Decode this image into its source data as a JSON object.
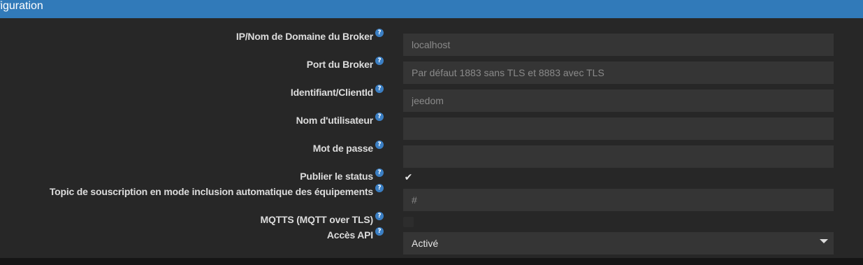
{
  "header": {
    "title": "figuration",
    "color": "#317ab9"
  },
  "help_glyph": "?",
  "fields": [
    {
      "label": "IP/Nom de Domaine du Broker",
      "value": "",
      "placeholder": "localhost"
    },
    {
      "label": "Port du Broker",
      "value": "",
      "placeholder": "Par défaut 1883 sans TLS et 8883 avec TLS"
    },
    {
      "label": "Identifiant/ClientId",
      "value": "",
      "placeholder": "jeedom"
    },
    {
      "label": "Nom d'utilisateur",
      "value": "",
      "placeholder": ""
    },
    {
      "label": "Mot de passe",
      "value": "",
      "placeholder": ""
    },
    {
      "label": "Publier le status",
      "checked": true,
      "check_glyph": "✔"
    },
    {
      "label": "Topic de souscription en mode inclusion automatique des équipements",
      "value": "",
      "placeholder": "#"
    },
    {
      "label": "MQTTS (MQTT over TLS)",
      "checked": false,
      "check_glyph": ""
    },
    {
      "label": "Accès API",
      "selected": "Activé"
    }
  ]
}
